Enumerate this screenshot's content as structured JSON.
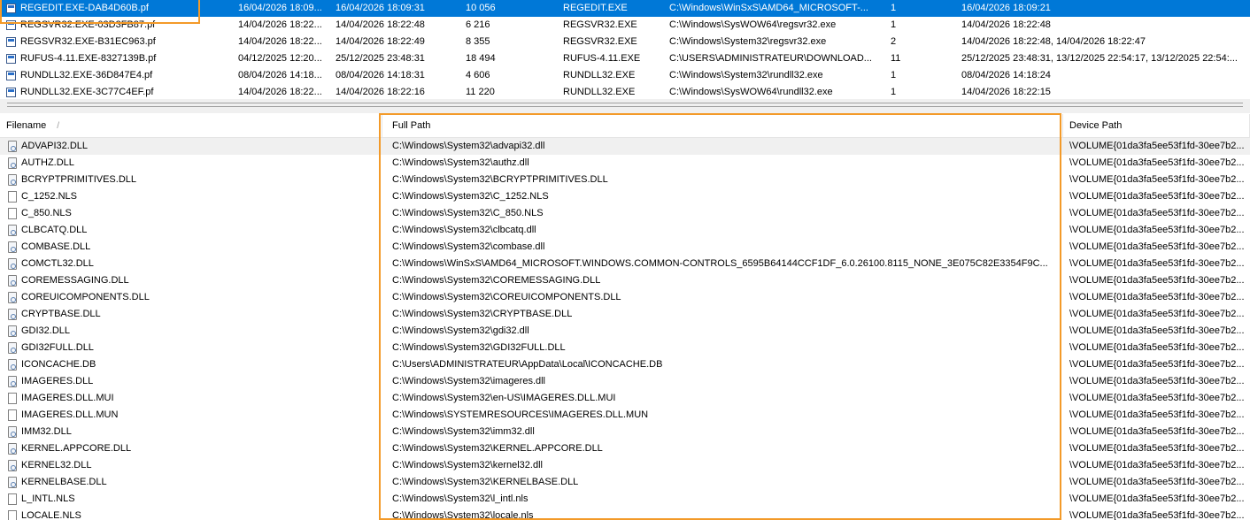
{
  "top_table": {
    "rows": [
      {
        "filename": "REGEDIT.EXE-DAB4D60B.pf",
        "created": "16/04/2026 18:09...",
        "modified": "16/04/2026 18:09:31",
        "size": "10 056",
        "process": "REGEDIT.EXE",
        "path": "C:\\Windows\\WinSxS\\AMD64_MICROSOFT-...",
        "runs": "1",
        "last_run": "16/04/2026 18:09:21",
        "selected": true
      },
      {
        "filename": "REGSVR32.EXE-03D3FB87.pf",
        "created": "14/04/2026 18:22...",
        "modified": "14/04/2026 18:22:48",
        "size": "6 216",
        "process": "REGSVR32.EXE",
        "path": "C:\\Windows\\SysWOW64\\regsvr32.exe",
        "runs": "1",
        "last_run": "14/04/2026 18:22:48"
      },
      {
        "filename": "REGSVR32.EXE-B31EC963.pf",
        "created": "14/04/2026 18:22...",
        "modified": "14/04/2026 18:22:49",
        "size": "8 355",
        "process": "REGSVR32.EXE",
        "path": "C:\\Windows\\System32\\regsvr32.exe",
        "runs": "2",
        "last_run": "14/04/2026 18:22:48, 14/04/2026 18:22:47"
      },
      {
        "filename": "RUFUS-4.11.EXE-8327139B.pf",
        "created": "04/12/2025 12:20...",
        "modified": "25/12/2025 23:48:31",
        "size": "18 494",
        "process": "RUFUS-4.11.EXE",
        "path": "C:\\USERS\\ADMINISTRATEUR\\DOWNLOAD...",
        "runs": "11",
        "last_run": "25/12/2025 23:48:31, 13/12/2025 22:54:17, 13/12/2025 22:54:..."
      },
      {
        "filename": "RUNDLL32.EXE-36D847E4.pf",
        "created": "08/04/2026 14:18...",
        "modified": "08/04/2026 14:18:31",
        "size": "4 606",
        "process": "RUNDLL32.EXE",
        "path": "C:\\Windows\\System32\\rundll32.exe",
        "runs": "1",
        "last_run": "08/04/2026 14:18:24"
      },
      {
        "filename": "RUNDLL32.EXE-3C77C4EF.pf",
        "created": "14/04/2026 18:22...",
        "modified": "14/04/2026 18:22:16",
        "size": "11 220",
        "process": "RUNDLL32.EXE",
        "path": "C:\\Windows\\SysWOW64\\rundll32.exe",
        "runs": "1",
        "last_run": "14/04/2026 18:22:15"
      }
    ]
  },
  "bottom_table": {
    "headers": {
      "filename": "Filename",
      "sort_indicator": "/",
      "full_path": "Full Path",
      "device_path": "Device Path"
    },
    "rows": [
      {
        "name": "ADVAPI32.DLL",
        "path": "C:\\Windows\\System32\\advapi32.dll",
        "device": "\\VOLUME{01da3fa5ee53f1fd-30ee7b2...",
        "icon": "dll-icon"
      },
      {
        "name": "AUTHZ.DLL",
        "path": "C:\\Windows\\System32\\authz.dll",
        "device": "\\VOLUME{01da3fa5ee53f1fd-30ee7b2...",
        "icon": "dll-icon"
      },
      {
        "name": "BCRYPTPRIMITIVES.DLL",
        "path": "C:\\Windows\\System32\\BCRYPTPRIMITIVES.DLL",
        "device": "\\VOLUME{01da3fa5ee53f1fd-30ee7b2...",
        "icon": "dll-icon"
      },
      {
        "name": "C_1252.NLS",
        "path": "C:\\Windows\\System32\\C_1252.NLS",
        "device": "\\VOLUME{01da3fa5ee53f1fd-30ee7b2...",
        "icon": "file-icon"
      },
      {
        "name": "C_850.NLS",
        "path": "C:\\Windows\\System32\\C_850.NLS",
        "device": "\\VOLUME{01da3fa5ee53f1fd-30ee7b2...",
        "icon": "file-icon"
      },
      {
        "name": "CLBCATQ.DLL",
        "path": "C:\\Windows\\System32\\clbcatq.dll",
        "device": "\\VOLUME{01da3fa5ee53f1fd-30ee7b2...",
        "icon": "dll-icon"
      },
      {
        "name": "COMBASE.DLL",
        "path": "C:\\Windows\\System32\\combase.dll",
        "device": "\\VOLUME{01da3fa5ee53f1fd-30ee7b2...",
        "icon": "dll-icon"
      },
      {
        "name": "COMCTL32.DLL",
        "path": "C:\\Windows\\WinSxS\\AMD64_MICROSOFT.WINDOWS.COMMON-CONTROLS_6595B64144CCF1DF_6.0.26100.8115_NONE_3E075C82E3354F9C...",
        "device": "\\VOLUME{01da3fa5ee53f1fd-30ee7b2...",
        "icon": "dll-icon"
      },
      {
        "name": "COREMESSAGING.DLL",
        "path": "C:\\Windows\\System32\\COREMESSAGING.DLL",
        "device": "\\VOLUME{01da3fa5ee53f1fd-30ee7b2...",
        "icon": "dll-icon"
      },
      {
        "name": "COREUICOMPONENTS.DLL",
        "path": "C:\\Windows\\System32\\COREUICOMPONENTS.DLL",
        "device": "\\VOLUME{01da3fa5ee53f1fd-30ee7b2...",
        "icon": "dll-icon"
      },
      {
        "name": "CRYPTBASE.DLL",
        "path": "C:\\Windows\\System32\\CRYPTBASE.DLL",
        "device": "\\VOLUME{01da3fa5ee53f1fd-30ee7b2...",
        "icon": "dll-icon"
      },
      {
        "name": "GDI32.DLL",
        "path": "C:\\Windows\\System32\\gdi32.dll",
        "device": "\\VOLUME{01da3fa5ee53f1fd-30ee7b2...",
        "icon": "dll-icon"
      },
      {
        "name": "GDI32FULL.DLL",
        "path": "C:\\Windows\\System32\\GDI32FULL.DLL",
        "device": "\\VOLUME{01da3fa5ee53f1fd-30ee7b2...",
        "icon": "dll-icon"
      },
      {
        "name": "ICONCACHE.DB",
        "path": "C:\\Users\\ADMINISTRATEUR\\AppData\\Local\\ICONCACHE.DB",
        "device": "\\VOLUME{01da3fa5ee53f1fd-30ee7b2...",
        "icon": "dll-icon"
      },
      {
        "name": "IMAGERES.DLL",
        "path": "C:\\Windows\\System32\\imageres.dll",
        "device": "\\VOLUME{01da3fa5ee53f1fd-30ee7b2...",
        "icon": "dll-icon"
      },
      {
        "name": "IMAGERES.DLL.MUI",
        "path": "C:\\Windows\\System32\\en-US\\IMAGERES.DLL.MUI",
        "device": "\\VOLUME{01da3fa5ee53f1fd-30ee7b2...",
        "icon": "file-icon"
      },
      {
        "name": "IMAGERES.DLL.MUN",
        "path": "C:\\Windows\\SYSTEMRESOURCES\\IMAGERES.DLL.MUN",
        "device": "\\VOLUME{01da3fa5ee53f1fd-30ee7b2...",
        "icon": "file-icon"
      },
      {
        "name": "IMM32.DLL",
        "path": "C:\\Windows\\System32\\imm32.dll",
        "device": "\\VOLUME{01da3fa5ee53f1fd-30ee7b2...",
        "icon": "dll-icon"
      },
      {
        "name": "KERNEL.APPCORE.DLL",
        "path": "C:\\Windows\\System32\\KERNEL.APPCORE.DLL",
        "device": "\\VOLUME{01da3fa5ee53f1fd-30ee7b2...",
        "icon": "dll-icon"
      },
      {
        "name": "KERNEL32.DLL",
        "path": "C:\\Windows\\System32\\kernel32.dll",
        "device": "\\VOLUME{01da3fa5ee53f1fd-30ee7b2...",
        "icon": "dll-icon"
      },
      {
        "name": "KERNELBASE.DLL",
        "path": "C:\\Windows\\System32\\KERNELBASE.DLL",
        "device": "\\VOLUME{01da3fa5ee53f1fd-30ee7b2...",
        "icon": "dll-icon"
      },
      {
        "name": "L_INTL.NLS",
        "path": "C:\\Windows\\System32\\l_intl.nls",
        "device": "\\VOLUME{01da3fa5ee53f1fd-30ee7b2...",
        "icon": "file-icon"
      },
      {
        "name": "LOCALE.NLS",
        "path": "C:\\Windows\\System32\\locale.nls",
        "device": "\\VOLUME{01da3fa5ee53f1fd-30ee7b2...",
        "icon": "file-icon"
      }
    ]
  },
  "colors": {
    "selection": "#0078d7",
    "highlight_box": "#f39a29",
    "row_hover": "#f0f0f0"
  }
}
